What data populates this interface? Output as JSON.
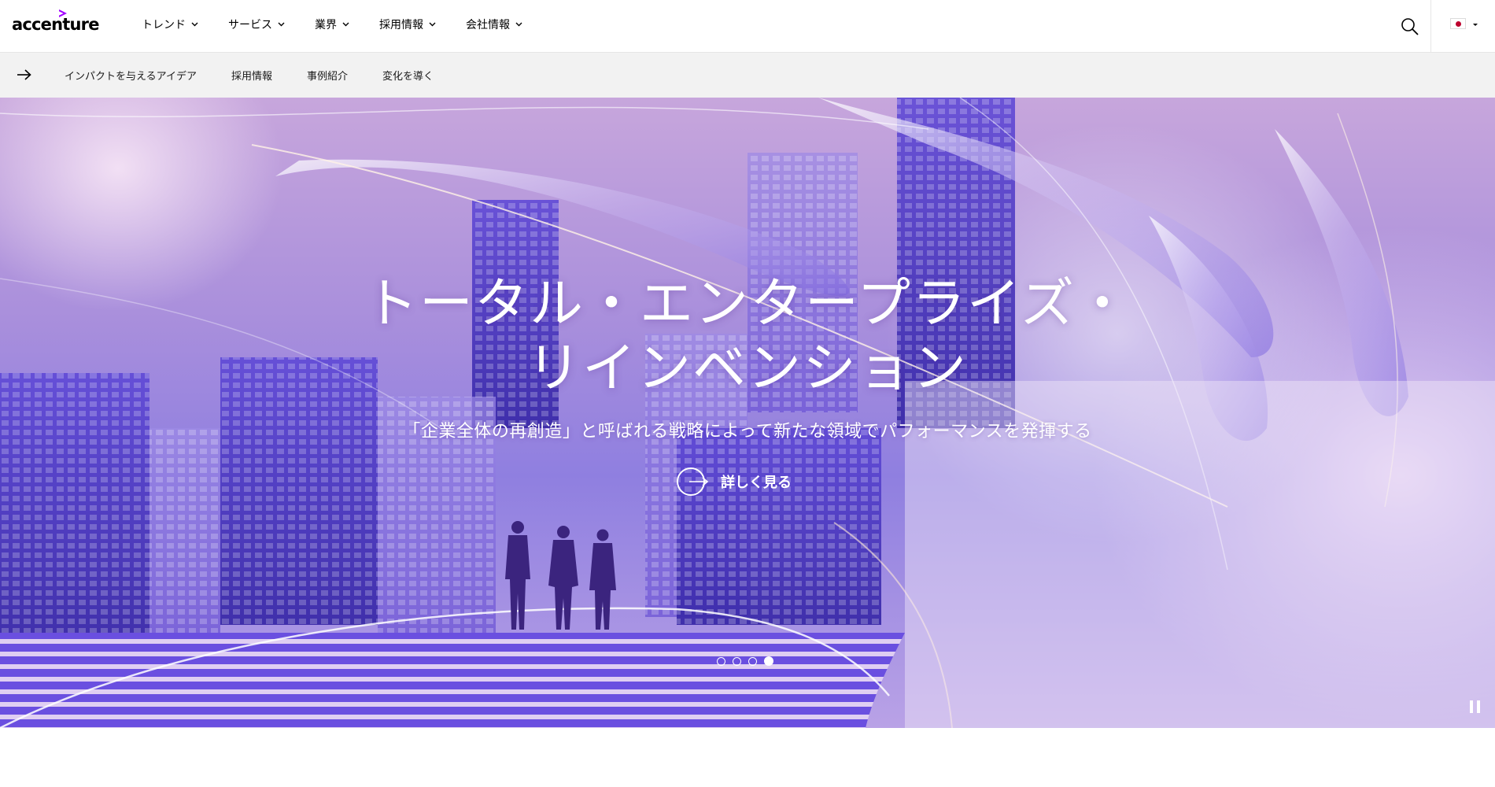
{
  "header": {
    "logo_text": "accenture",
    "nav": [
      {
        "label": "トレンド"
      },
      {
        "label": "サービス"
      },
      {
        "label": "業界"
      },
      {
        "label": "採用情報"
      },
      {
        "label": "会社情報"
      }
    ],
    "icons": {
      "search": "search-icon",
      "locale": "japan-flag-icon"
    }
  },
  "subnav": {
    "items": [
      {
        "label": "インパクトを与えるアイデア"
      },
      {
        "label": "採用情報"
      },
      {
        "label": "事例紹介"
      },
      {
        "label": "変化を導く"
      }
    ]
  },
  "hero": {
    "title": "トータル・エンタープライズ・リインベンション",
    "subtitle": "「企業全体の再創造」と呼ばれる戦略によって新たな領域でパフォーマンスを発揮する",
    "cta_label": "詳しく見る",
    "slides_total": 4,
    "slide_active": 4
  },
  "colors": {
    "brand_accent": "#a100ff",
    "hero_purple": "#8f7fe0",
    "text": "#000000"
  }
}
